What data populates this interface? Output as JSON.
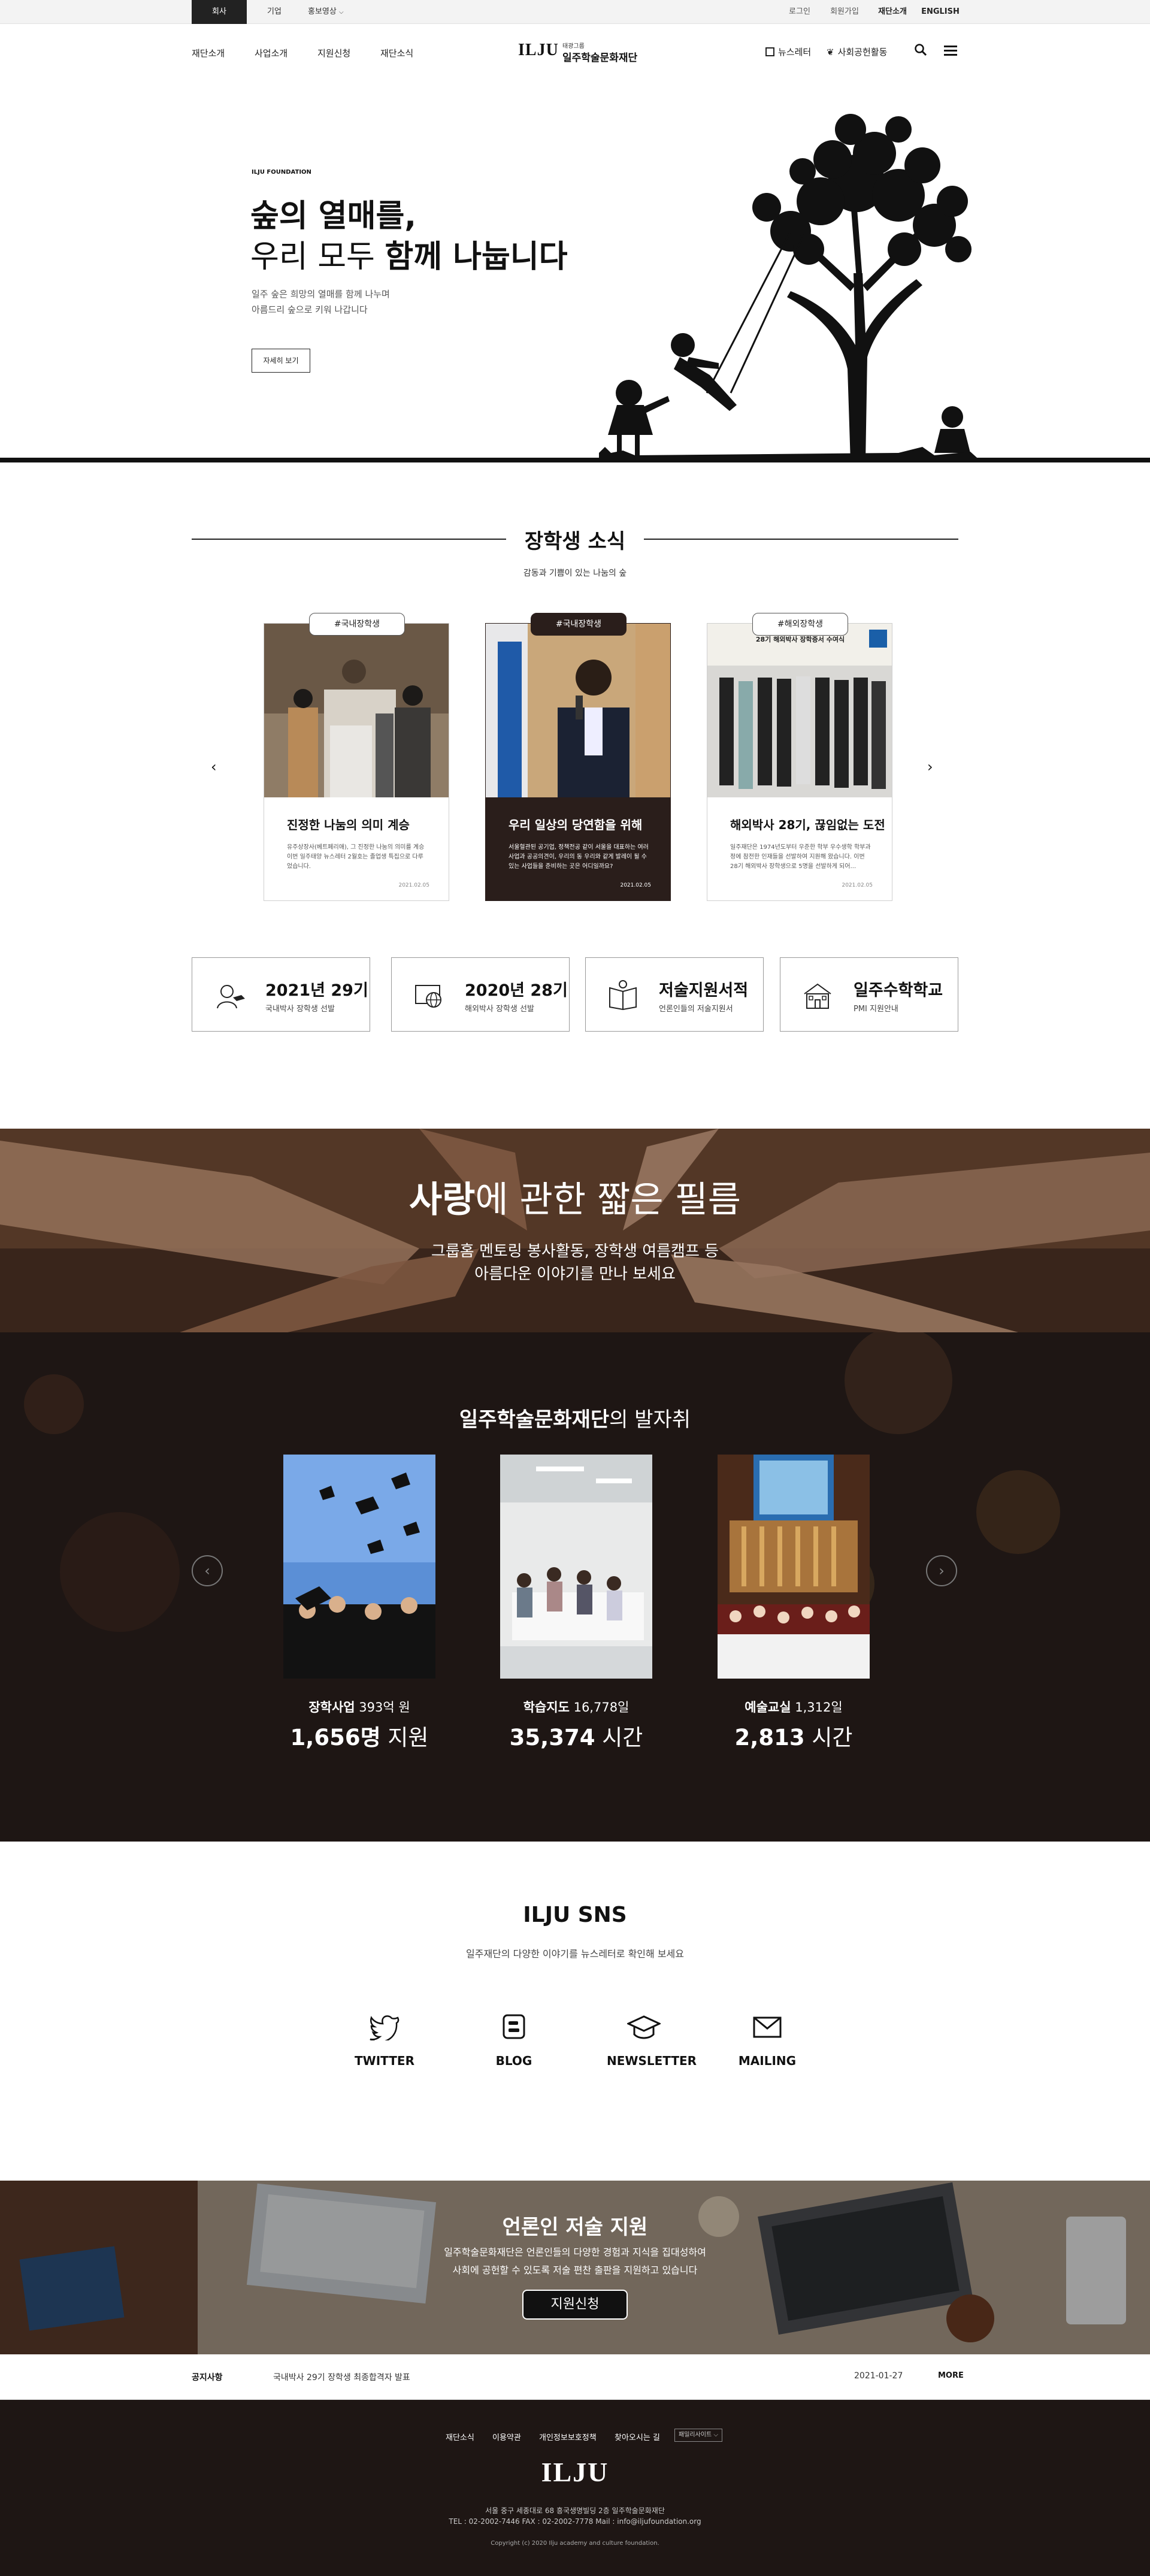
{
  "topbar": {
    "tabs": [
      "회사",
      "기업"
    ],
    "promo": "홍보영상",
    "links": [
      "로그인",
      "회원가입",
      "재단소개",
      "ENGLISH"
    ]
  },
  "gnb": {
    "menu": [
      "재단소개",
      "사업소개",
      "지원신청",
      "재단소식"
    ],
    "logo_mark": "ILJU",
    "logo_sub": "태광그룹",
    "logo_name": "일주학술문화재단",
    "util": [
      "뉴스레터",
      "사회공헌활동"
    ]
  },
  "hero": {
    "eyebrow": "ILJU FOUNDATION",
    "line1": "숲의 열매를,",
    "line2_pre": "우리 모두 ",
    "line2_bold": "함께 나눕니다",
    "desc1": "일주 숲은 희망의 열매를 함께 나누며",
    "desc2": "아름드리 숲으로 키워 나갑니다",
    "button": "자세히 보기"
  },
  "scholar": {
    "title": "장학생 소식",
    "subtitle": "감동과 기쁨이 있는 나눔의 숲",
    "cards": [
      {
        "tag": "#국내장학생",
        "title": "진정한 나눔의 의미 계승",
        "desc": "유주상장사(베트페리애), 그 진정한 나눔의 의미를 계승 이번 일주태양 뉴스레터 2월호는 졸업생 특집으로 다루었습니다.",
        "date": "2021.02.05"
      },
      {
        "tag": "#국내장학생",
        "title": "우리 일상의 당연함을 위해",
        "desc": "서울혈관된 공기업, 정책전공 같이 서울을 대표하는 여러 사업과 공공의견이, 우리의 동 우리와 같게 발레이 될 수 있는 사업들을 준비하는 곳은 어디일까요?",
        "date": "2021.02.05"
      },
      {
        "tag": "#해외장학생",
        "title": "해외박사 28기, 끊임없는 도전",
        "desc": "일주재단은 1974년도부터 우준한 학부 우수생학 학부과정에 참전한 인재들을 선발하여 지원해 왔습니다. 이번 28기 해외박사 장학생으로 5명을 선발하게 되어...",
        "date": "2021.02.05",
        "photo_caption": "28기 해외박사 장학증서 수여식"
      }
    ],
    "quick": [
      {
        "title": "2021년 29기",
        "sub": "국내박사 장학생 선발",
        "icon": "graduate-icon"
      },
      {
        "title": "2020년 28기",
        "sub": "해외박사 장학생 선발",
        "icon": "globe-icon"
      },
      {
        "title": "저술지원서적",
        "sub": "언론인들의 저술지원서",
        "icon": "book-icon"
      },
      {
        "title": "일주수학학교",
        "sub": "PMI 지원안내",
        "icon": "school-icon"
      }
    ]
  },
  "film": {
    "title_bold": "사랑",
    "title_rest": "에 관한 짧은 필름",
    "line1": "그룹홈 멘토링 봉사활동, 장학생 여름캠프 등",
    "line2": "아름다운 이야기를 만나 보세요"
  },
  "footsteps": {
    "title_bold": "일주학술문화재단",
    "title_rest": "의 발자취",
    "items": [
      {
        "label": "장학사업",
        "label_val": "393억 원",
        "big": "1,656명",
        "unit": "지원"
      },
      {
        "label": "학습지도",
        "label_val": "16,778일",
        "big": "35,374",
        "unit": "시간"
      },
      {
        "label": "예술교실",
        "label_val": "1,312일",
        "big": "2,813",
        "unit": "시간"
      }
    ]
  },
  "sns": {
    "title": "ILJU SNS",
    "subtitle": "일주재단의 다양한 이야기를 뉴스레터로 확인해 보세요",
    "items": [
      {
        "label": "TWITTER",
        "icon": "twitter-icon"
      },
      {
        "label": "BLOG",
        "icon": "blog-icon"
      },
      {
        "label": "NEWSLETTER",
        "icon": "graduation-cap-icon"
      },
      {
        "label": "MAILING",
        "icon": "mail-icon"
      }
    ]
  },
  "media": {
    "title": "언론인 저술 지원",
    "line1": "일주학술문화재단은 언론인들의 다양한 경험과 지식을 집대성하여",
    "line2": "사회에 공헌할 수 있도록 저술 편찬 출판을 지원하고 있습니다",
    "button": "지원신청"
  },
  "notice": {
    "label": "공지사항",
    "text": "국내박사 29기 장학생 최종합격자 발표",
    "date": "2021-01-27",
    "more": "MORE"
  },
  "footer": {
    "links": [
      "재단소식",
      "이용약관",
      "개인정보보호정책",
      "찾아오시는 길"
    ],
    "family": "패밀리사이트",
    "logo": "ILJU",
    "address": "서울 중구 세종대로 68 흥국생명빌딩 2층 일주학술문화재단",
    "contact": "TEL : 02-2002-7446 FAX : 02-2002-7778 Mail : info@iljufoundation.org",
    "copyright": "Copyright (c) 2020 Ilju academy and culture foundation."
  },
  "colors": {
    "dark": "#1e1614",
    "card_dark": "#2a1e1b",
    "text": "#111111"
  }
}
